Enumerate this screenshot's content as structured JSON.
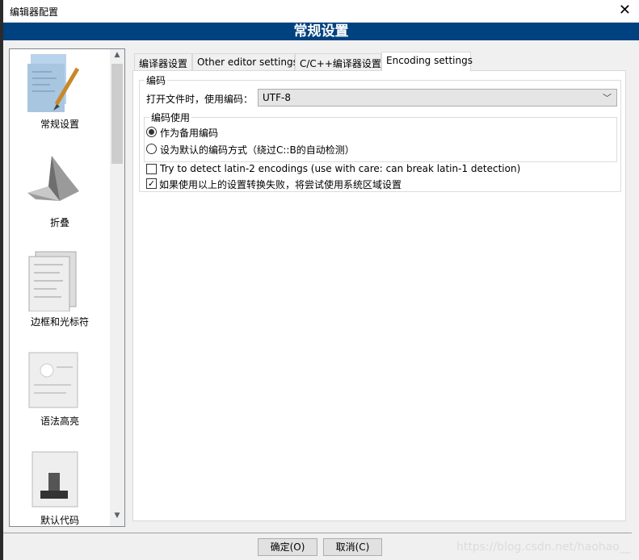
{
  "window": {
    "title": "编辑器配置",
    "close_icon": "close-icon"
  },
  "banner": {
    "title": "常规设置"
  },
  "sidebar": {
    "items": [
      {
        "label": "常规设置",
        "icon": "general-settings-icon"
      },
      {
        "label": "折叠",
        "icon": "folding-icon"
      },
      {
        "label": "边框和光标符",
        "icon": "margins-caret-icon"
      },
      {
        "label": "语法高亮",
        "icon": "syntax-highlight-icon"
      },
      {
        "label": "默认代码",
        "icon": "default-code-icon"
      }
    ]
  },
  "tabs": [
    {
      "label": "编译器设置",
      "selected": false
    },
    {
      "label": "Other editor settings",
      "selected": false
    },
    {
      "label": "C/C++编译器设置",
      "selected": false
    },
    {
      "label": "Encoding settings",
      "selected": true
    }
  ],
  "encoding": {
    "group_label": "编码",
    "open_label": "打开文件时，使用编码：",
    "encoding_value": "UTF-8",
    "usage_group_label": "编码使用",
    "radios": [
      {
        "label": "作为备用编码",
        "checked": true
      },
      {
        "label": "设为默认的编码方式（绕过C::B的自动检测）",
        "checked": false
      }
    ],
    "checkboxes": [
      {
        "label": "Try to detect latin-2 encodings (use with care: can break latin-1 detection)",
        "checked": false
      },
      {
        "label": "如果使用以上的设置转换失败，将尝试使用系统区域设置",
        "checked": true
      }
    ]
  },
  "buttons": {
    "ok": "确定(O)",
    "cancel": "取消(C)"
  },
  "watermark": "https://blog.csdn.net/haohao__"
}
